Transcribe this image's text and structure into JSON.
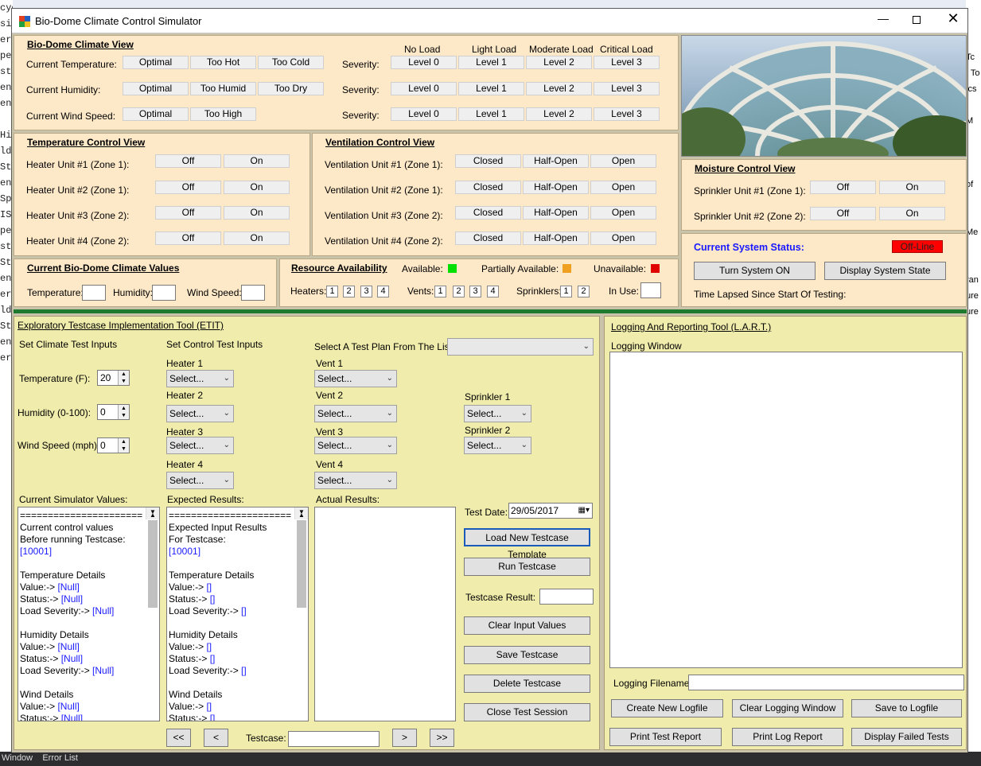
{
  "window": {
    "title": "Bio-Dome Climate Control Simulator"
  },
  "climate_view": {
    "header": "Bio-Dome Climate View",
    "load_headers": [
      "No Load",
      "Light Load",
      "Moderate Load",
      "Critical Load"
    ],
    "rows": [
      {
        "label": "Current Temperature:",
        "states": [
          "Optimal",
          "Too Hot",
          "Too Cold"
        ],
        "severity_label": "Severity:",
        "levels": [
          "Level 0",
          "Level 1",
          "Level 2",
          "Level 3"
        ]
      },
      {
        "label": "Current Humidity:",
        "states": [
          "Optimal",
          "Too Humid",
          "Too Dry"
        ],
        "severity_label": "Severity:",
        "levels": [
          "Level 0",
          "Level 1",
          "Level 2",
          "Level 3"
        ]
      },
      {
        "label": "Current Wind Speed:",
        "states": [
          "Optimal",
          "Too High"
        ],
        "severity_label": "Severity:",
        "levels": [
          "Level 0",
          "Level 1",
          "Level 2",
          "Level 3"
        ]
      }
    ]
  },
  "temperature_control": {
    "header": "Temperature Control View",
    "rows": [
      {
        "label": "Heater Unit #1 (Zone 1):",
        "states": [
          "Off",
          "On"
        ]
      },
      {
        "label": "Heater Unit #2 (Zone 1):",
        "states": [
          "Off",
          "On"
        ]
      },
      {
        "label": "Heater Unit #3 (Zone 2):",
        "states": [
          "Off",
          "On"
        ]
      },
      {
        "label": "Heater Unit #4 (Zone 2):",
        "states": [
          "Off",
          "On"
        ]
      }
    ]
  },
  "ventilation_control": {
    "header": "Ventilation Control View",
    "rows": [
      {
        "label": "Ventilation Unit #1 (Zone 1):",
        "states": [
          "Closed",
          "Half-Open",
          "Open"
        ]
      },
      {
        "label": "Ventilation Unit #2 (Zone 1):",
        "states": [
          "Closed",
          "Half-Open",
          "Open"
        ]
      },
      {
        "label": "Ventilation Unit #3 (Zone 2):",
        "states": [
          "Closed",
          "Half-Open",
          "Open"
        ]
      },
      {
        "label": "Ventilation Unit #4 (Zone 2):",
        "states": [
          "Closed",
          "Half-Open",
          "Open"
        ]
      }
    ]
  },
  "moisture_control": {
    "header": "Moisture Control View",
    "rows": [
      {
        "label": "Sprinkler Unit #1 (Zone 1):",
        "states": [
          "Off",
          "On"
        ]
      },
      {
        "label": "Sprinkler Unit #2 (Zone 2):",
        "states": [
          "Off",
          "On"
        ]
      }
    ]
  },
  "climate_values": {
    "header": "Current Bio-Dome Climate Values",
    "temperature_label": "Temperature:",
    "humidity_label": "Humidity:",
    "wind_label": "Wind Speed:"
  },
  "resources": {
    "header": "Resource Availability",
    "available_label": "Available:",
    "partial_label": "Partially Available:",
    "unavailable_label": "Unavailable:",
    "available_color": "#00e000",
    "partial_color": "#f0a020",
    "unavailable_color": "#e00000",
    "heaters_label": "Heaters:",
    "heaters": [
      "1",
      "2",
      "3",
      "4"
    ],
    "vents_label": "Vents:",
    "vents": [
      "1",
      "2",
      "3",
      "4"
    ],
    "sprinklers_label": "Sprinklers:",
    "sprinklers": [
      "1",
      "2"
    ],
    "in_use_label": "In Use:"
  },
  "system": {
    "status_label": "Current System Status:",
    "status_value": "Off-Line",
    "status_color": "#ff0000",
    "turn_on": "Turn System ON",
    "display_state": "Display System State",
    "time_lapsed": "Time Lapsed Since Start Of Testing:"
  },
  "etit": {
    "header": "Exploratory Testcase Implementation Tool (ETIT)",
    "climate_inputs_label": "Set Climate Test Inputs",
    "control_inputs_label": "Set Control Test Inputs",
    "test_plan_label": "Select A Test Plan From The List:",
    "temperature_label": "Temperature (F):",
    "temperature_value": "20",
    "humidity_label": "Humidity (0-100):",
    "humidity_value": "0",
    "wind_label": "Wind Speed (mph):",
    "wind_value": "0",
    "heaters": [
      "Heater 1",
      "Heater 2",
      "Heater 3",
      "Heater 4"
    ],
    "vents": [
      "Vent 1",
      "Vent 2",
      "Vent 3",
      "Vent 4"
    ],
    "sprinklers": [
      "Sprinkler 1",
      "Sprinkler 2"
    ],
    "select_placeholder": "Select...",
    "current_values_label": "Current Simulator Values:",
    "expected_label": "Expected Results:",
    "actual_label": "Actual Results:",
    "current_values_text": [
      {
        "t": "======================",
        "c": ""
      },
      {
        "t": "Current control values",
        "c": ""
      },
      {
        "t": "Before running Testcase:",
        "c": ""
      },
      {
        "t": "[10001]",
        "c": "blue"
      },
      {
        "t": "",
        "c": ""
      },
      {
        "t": "Temperature Details",
        "c": ""
      },
      {
        "t": "Value:->",
        "v": "[Null]"
      },
      {
        "t": "Status:->",
        "v": "[Null]"
      },
      {
        "t": "Load Severity:->",
        "v": "[Null]"
      },
      {
        "t": "",
        "c": ""
      },
      {
        "t": "Humidity Details",
        "c": ""
      },
      {
        "t": "Value:->",
        "v": "[Null]"
      },
      {
        "t": "Status:->",
        "v": "[Null]"
      },
      {
        "t": "Load Severity:->",
        "v": "[Null]"
      },
      {
        "t": "",
        "c": ""
      },
      {
        "t": "Wind Details",
        "c": ""
      },
      {
        "t": "Value:->",
        "v": "[Null]"
      },
      {
        "t": "Status:->",
        "v": "[Null]"
      }
    ],
    "expected_text": [
      {
        "t": "======================",
        "c": ""
      },
      {
        "t": "Expected Input Results",
        "c": ""
      },
      {
        "t": "For Testcase:",
        "c": ""
      },
      {
        "t": "[10001]",
        "c": "blue"
      },
      {
        "t": "",
        "c": ""
      },
      {
        "t": "Temperature Details",
        "c": ""
      },
      {
        "t": "Value:->",
        "v": "[]"
      },
      {
        "t": "Status:->",
        "v": "[]"
      },
      {
        "t": "Load Severity:->",
        "v": "[]"
      },
      {
        "t": "",
        "c": ""
      },
      {
        "t": "Humidity Details",
        "c": ""
      },
      {
        "t": "Value:->",
        "v": "[]"
      },
      {
        "t": "Status:->",
        "v": "[]"
      },
      {
        "t": "Load Severity:->",
        "v": "[]"
      },
      {
        "t": "",
        "c": ""
      },
      {
        "t": "Wind Details",
        "c": ""
      },
      {
        "t": "Value:->",
        "v": "[]"
      },
      {
        "t": "Status:->",
        "v": "[]"
      }
    ],
    "test_date_label": "Test Date:",
    "test_date_value": "29/05/2017",
    "load_template": "Load New Testcase Template",
    "run_testcase": "Run Testcase",
    "result_label": "Testcase Result:",
    "clear_inputs": "Clear Input Values",
    "save_testcase": "Save Testcase",
    "delete_testcase": "Delete Testcase",
    "close_session": "Close Test Session",
    "nav_first": "<<",
    "nav_prev": "<",
    "testcase_label": "Testcase:",
    "nav_next": ">",
    "nav_last": ">>"
  },
  "lart": {
    "header": "Logging And Reporting Tool (L.A.R.T.)",
    "logging_window_label": "Logging Window",
    "filename_label": "Logging Filename:",
    "create_logfile": "Create New Logfile",
    "clear_logging": "Clear Logging Window",
    "save_logfile": "Save to Logfile",
    "print_test_report": "Print Test Report",
    "print_log_report": "Print Log Report",
    "display_failed": "Display Failed Tests"
  },
  "background": {
    "left_text": [
      "cyc",
      "sig",
      "er",
      "pe",
      "st",
      "en",
      "en",
      "",
      "Hi",
      "ld",
      "St",
      "en",
      "Sp",
      "IS",
      "pe",
      "st",
      "St",
      "en",
      "er",
      "ld",
      "St",
      "en",
      "er"
    ],
    "right_text": [
      "Tc",
      "t To",
      "ics",
      "",
      "M",
      "",
      "",
      "",
      "of",
      "",
      "",
      "Me",
      "",
      "t",
      "ran",
      "ure",
      "ure"
    ],
    "bottom_text": "Window    Error List"
  }
}
